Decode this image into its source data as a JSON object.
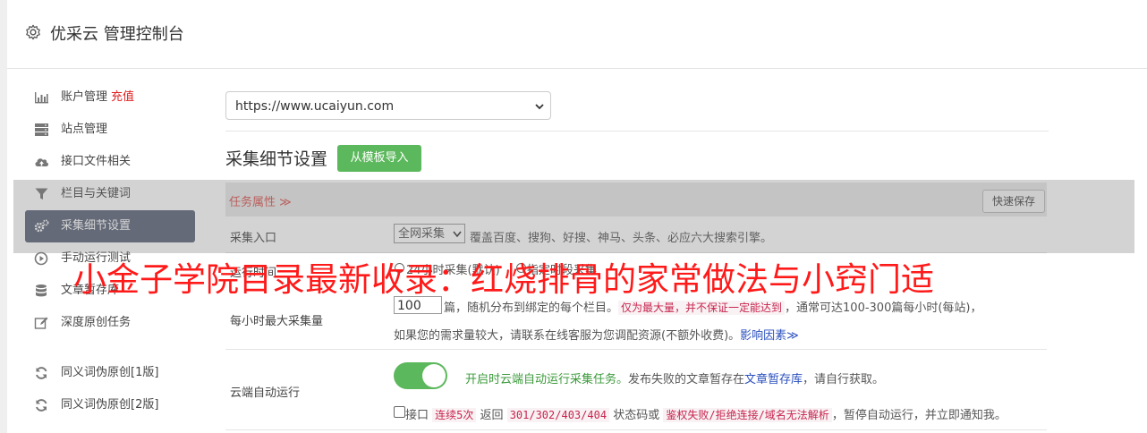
{
  "header": {
    "title": "优采云 管理控制台"
  },
  "sidebar": {
    "items": [
      {
        "label": "账户管理",
        "extra": "充值"
      },
      {
        "label": "站点管理"
      },
      {
        "label": "接口文件相关"
      },
      {
        "label": "栏目与关键词"
      },
      {
        "label": "采集细节设置"
      },
      {
        "label": "手动运行测试"
      },
      {
        "label": "文章暂存库"
      },
      {
        "label": "深度原创任务"
      },
      {
        "label": "同义词伪原创[1版]"
      },
      {
        "label": "同义词伪原创[2版]"
      }
    ]
  },
  "content": {
    "site_select": "https://www.ucaiyun.com",
    "section_title": "采集细节设置",
    "import_button": "从模板导入",
    "task_props": "任务属性 ≫",
    "quick_save": "快速保存",
    "collect_entry": {
      "label": "采集入口",
      "select": "全网采集",
      "desc": "覆盖百度、搜狗、好搜、神马、头条、必应六大搜索引擎。"
    },
    "run_time": {
      "label": "运行时间",
      "opt1": "24小时采集(默认)",
      "opt2": "指定时段采集"
    },
    "max_per_hour": {
      "label": "每小时最大采集量",
      "value": "100",
      "t1": "篇，随机分布到绑定的每个栏目。",
      "code": "仅为最大量，并不保证一定能达到",
      "t2": "，通常可达100-300篇每小时(每站)，",
      "t3": "如果您的需求量较大，请联系在线客服为您调配资源(不额外收费)。",
      "link": "影响因素≫"
    },
    "cloud_run": {
      "label": "云端自动运行",
      "green_text": "开启时云端自动运行采集任务。",
      "t1": "发布失败的文章暂存在",
      "link": "文章暂存库",
      "t2": "，请自行获取。",
      "c_t1": "接口",
      "c_code1": "连续5次",
      "c_t2": "返回",
      "c_code2": "301/302/403/404",
      "c_t3": "状态码或",
      "c_code3": "鉴权失败/拒绝连接/域名无法解析",
      "c_t4": "，暂停自动运行，并立即通知我。"
    }
  },
  "watermark": "小金子学院目录最新收录：红烧排骨的家常做法与小窍门适"
}
